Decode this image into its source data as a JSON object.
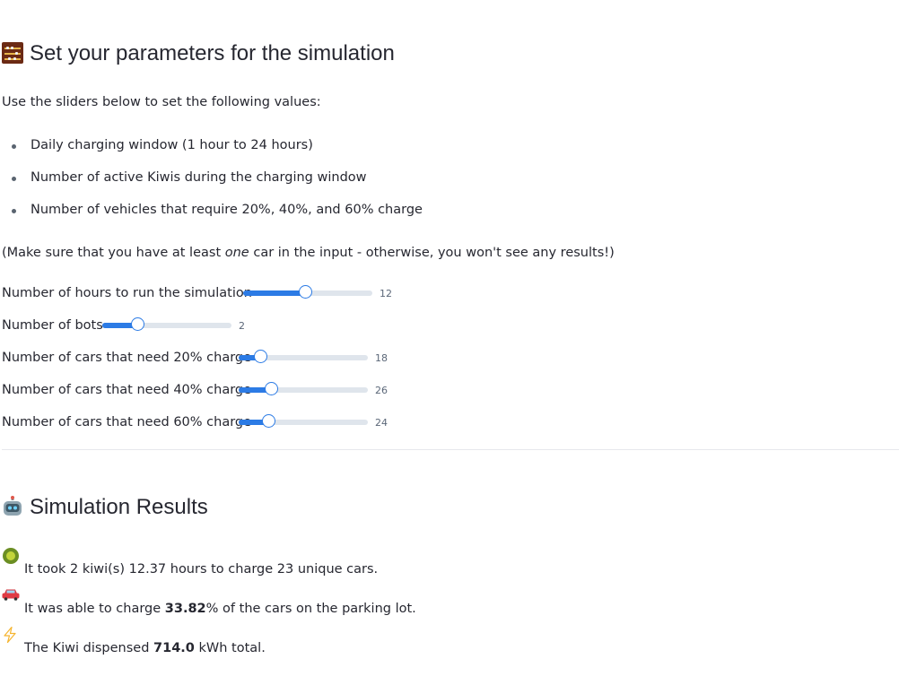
{
  "params_section": {
    "title": "Set your parameters for the simulation",
    "intro": "Use the sliders below to set the following values:",
    "bullets": [
      "Daily charging window (1 hour to 24 hours)",
      "Number of active Kiwis during the charging window",
      "Number of vehicles that require 20%, 40%, and 60% charge"
    ],
    "note_before": "(Make sure that you have at least ",
    "note_emph": "one",
    "note_after": " car in the input - otherwise, you won't see any results!)"
  },
  "sliders": [
    {
      "label": "Number of hours to run the simulation",
      "value": "12",
      "fraction": 0.48
    },
    {
      "label": "Number of bots",
      "value": "2",
      "fraction": 0.27
    },
    {
      "label": "Number of cars that need 20% charge",
      "value": "18",
      "fraction": 0.17
    },
    {
      "label": "Number of cars that need 40% charge",
      "value": "26",
      "fraction": 0.25
    },
    {
      "label": "Number of cars that need 60% charge",
      "value": "24",
      "fraction": 0.23
    }
  ],
  "results_section": {
    "title": "Simulation Results",
    "line1": "It took 2 kiwi(s) 12.37 hours to charge 23 unique cars.",
    "line2_before": "It was able to charge ",
    "line2_bold": "33.82",
    "line2_after": "% of the cars on the parking lot.",
    "line3_before": "The Kiwi dispensed ",
    "line3_bold": "714.0",
    "line3_after": " kWh total."
  },
  "colors": {
    "accent": "#2c7be5",
    "track": "#dfe5ec",
    "text": "#262730"
  },
  "icons": [
    "abacus-icon",
    "robot-icon",
    "kiwi-icon",
    "car-icon",
    "lightning-icon"
  ]
}
